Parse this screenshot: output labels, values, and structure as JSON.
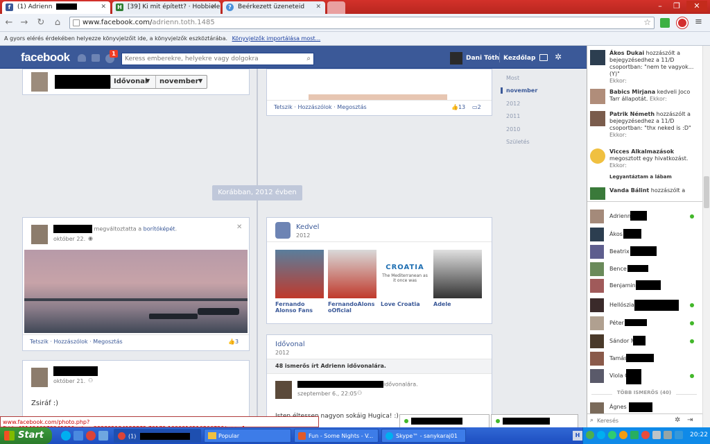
{
  "browser": {
    "tabs": [
      {
        "label": "(1) Adrienn"
      },
      {
        "label": "[39] Ki mit épített? · Hobbiele"
      },
      {
        "label": "Beérkezett üzeneteid"
      }
    ],
    "url_host": "www.facebook.com/",
    "url_path": "adrienn.toth.1485",
    "bookmarks_text": "A gyors elérés érdekében helyezze könyvjelzőit ide, a könyvjelzők eszköztárába.",
    "bookmarks_link": "Könyvjelzők importálása most..."
  },
  "fb": {
    "logo": "facebook",
    "notif_count": "1",
    "search_placeholder": "Keress emberekre, helyekre vagy dolgokra",
    "user_name": "Dani Tóth",
    "home": "Kezdőlap"
  },
  "timeline": {
    "dropdown1": "Idővonal",
    "dropdown2": "november",
    "post_actions": "Tetszik · Hozzászólok · Megosztás",
    "likes1": "13",
    "comments1": "2",
    "divider": "Korábban, 2012 évben",
    "cover_post": {
      "text1": "megváltoztatta a ",
      "link": "borítóképét",
      "text2": ".",
      "date": "október 22.",
      "actions": "Tetszik · Hozzászólok · Megosztás",
      "likes": "3"
    },
    "status_post": {
      "date": "október 21.",
      "text": "Zsiráf :)"
    },
    "likes_box": {
      "title": "Kedvel",
      "year": "2012",
      "items": [
        "Fernando Alonso Fans",
        "FernandoAlonsoOficial",
        "Love Croatia",
        "Adele"
      ]
    },
    "croatia_logo": "CROATIA",
    "croatia_tagline": "The Mediterranean as it once was",
    "timeline_box": {
      "title": "Idővonal",
      "year": "2012",
      "summary": "48 ismerős írt Adrienn idővonalára.",
      "suffix": "idővonalára.",
      "date": "szeptember 6., 22:05",
      "text": "Isten éltessen nagyon sokáig Hugica! :)"
    },
    "sidenav": [
      "Most",
      "november",
      "2012",
      "2011",
      "2010",
      "Születés"
    ]
  },
  "ticker": [
    {
      "name": "Ákos Dukai",
      "text": " hozzászólt a bejegyzésedhez a 11/D csoportban: \"nem te vagyok... (Y)\"",
      "time": "Ekkor:"
    },
    {
      "name": "Babics Mirjana",
      "text": " kedveli Joco Tarr állapotát.",
      "time": "Ekkor:"
    },
    {
      "name": "Patrik Németh",
      "text": " hozzászólt a bejegyzésedhez a 11/D csoportban: \"thx neked is :D\"",
      "time": "Ekkor:"
    },
    {
      "name": "Vicces Alkalmazások",
      "text": " megosztott egy hivatkozást.",
      "time": "Ekkor:",
      "extra": "Legyantáztam a lábam"
    },
    {
      "name": "Vanda Bálint",
      "text": " hozzászólt a",
      "time": ""
    }
  ],
  "friends": [
    {
      "name": "Adrienn",
      "online": true
    },
    {
      "name": "Ákos",
      "online": false
    },
    {
      "name": "Beatrix",
      "online": false
    },
    {
      "name": "Bence",
      "online": false
    },
    {
      "name": "Benjamin",
      "online": false
    },
    {
      "name": "Hellószia",
      "online": true
    },
    {
      "name": "Péter",
      "online": true
    },
    {
      "name": "Sándor M",
      "online": true
    },
    {
      "name": "Tamás",
      "online": false
    },
    {
      "name": "Viola G",
      "online": true
    }
  ],
  "more_friends": "TÖBB ISMERŐS (40)",
  "more_friend_name": "Ágnes",
  "chat_search": "Keresés",
  "status_url": "www.facebook.com/photo.php?fbid=421404607924592&set=a.292395124158875.70179.100001651686672&type=1",
  "taskbar": {
    "start": "Start",
    "items": [
      "(1)",
      "Popular",
      "Fun - Some Nights - V...",
      "Skype™ - sanykaraj01"
    ],
    "clock": "20:22"
  }
}
